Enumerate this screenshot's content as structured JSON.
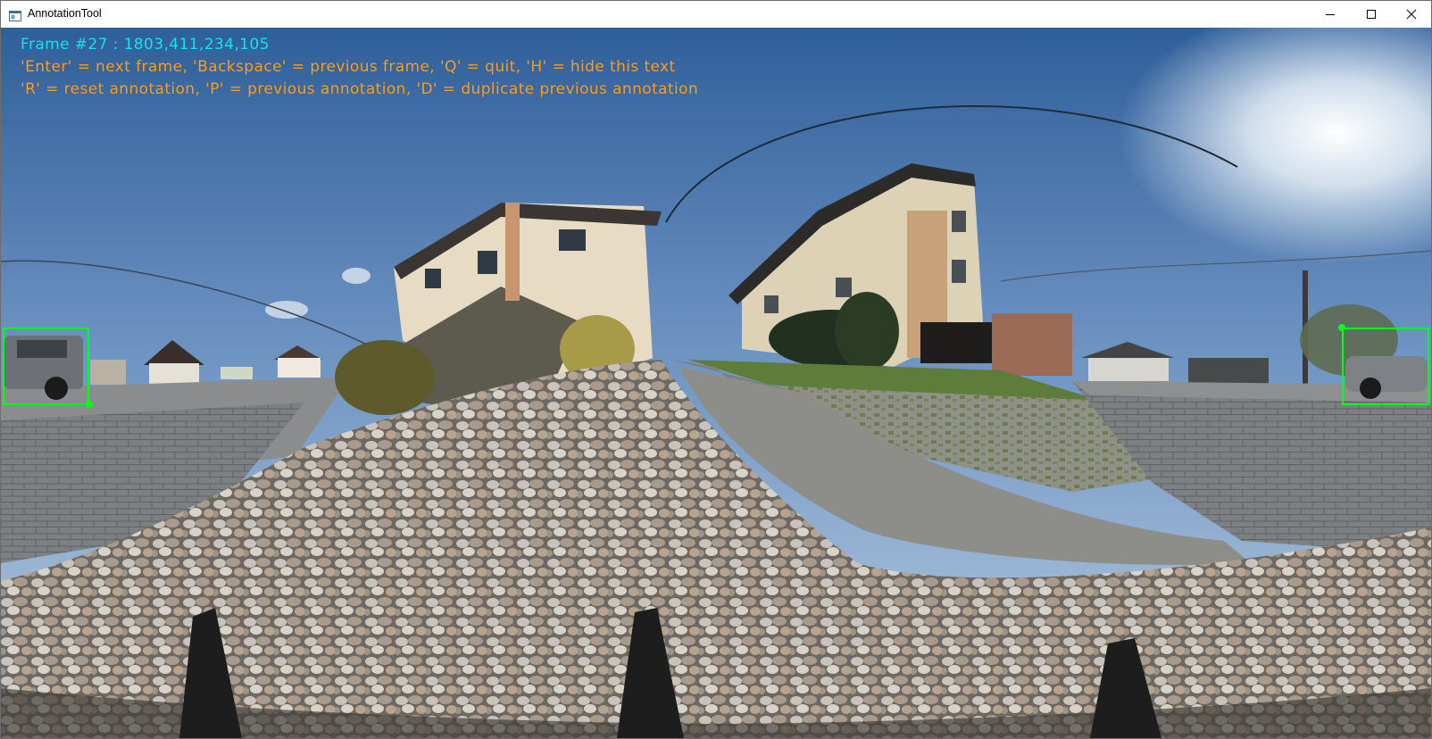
{
  "window": {
    "title": "AnnotationTool",
    "app_icon": "window-app-icon",
    "controls": {
      "minimize_icon": "minimize-icon",
      "maximize_icon": "maximize-icon",
      "close_icon": "close-icon"
    }
  },
  "overlay": {
    "frame_info": "Frame #27 : 1803,411,234,105",
    "help_line_1": "'Enter' = next frame, 'Backspace' = previous frame, 'Q' = quit, 'H' = hide this text",
    "help_line_2": "'R' = reset annotation, 'P' = previous annotation, 'D' = duplicate previous annotation"
  },
  "colors": {
    "frame_text": "#14e6f0",
    "help_text": "#ff9e1a",
    "bbox": "#00ff1a"
  }
}
